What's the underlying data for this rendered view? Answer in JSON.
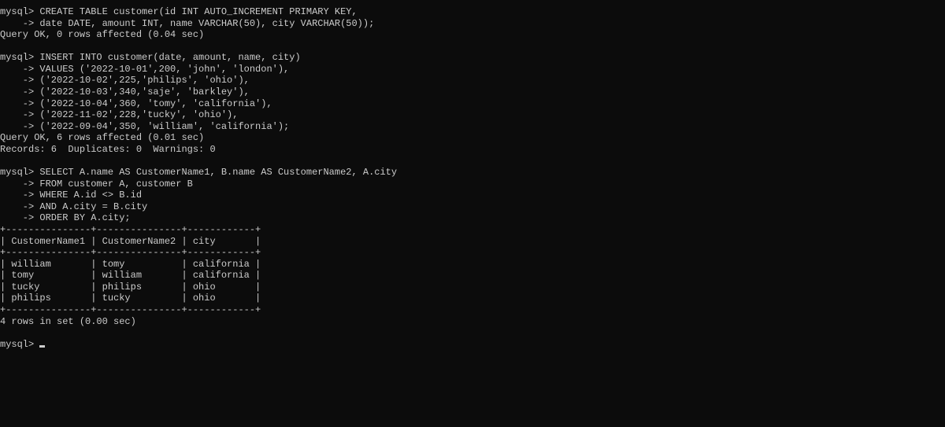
{
  "terminal": {
    "lines": [
      "mysql> CREATE TABLE customer(id INT AUTO_INCREMENT PRIMARY KEY,",
      "    -> date DATE, amount INT, name VARCHAR(50), city VARCHAR(50));",
      "Query OK, 0 rows affected (0.04 sec)",
      "",
      "mysql> INSERT INTO customer(date, amount, name, city)",
      "    -> VALUES ('2022-10-01',200, 'john', 'london'),",
      "    -> ('2022-10-02',225,'philips', 'ohio'),",
      "    -> ('2022-10-03',340,'saje', 'barkley'),",
      "    -> ('2022-10-04',360, 'tomy', 'california'),",
      "    -> ('2022-11-02',228,'tucky', 'ohio'),",
      "    -> ('2022-09-04',350, 'william', 'california');",
      "Query OK, 6 rows affected (0.01 sec)",
      "Records: 6  Duplicates: 0  Warnings: 0",
      "",
      "mysql> SELECT A.name AS CustomerName1, B.name AS CustomerName2, A.city",
      "    -> FROM customer A, customer B",
      "    -> WHERE A.id <> B.id",
      "    -> AND A.city = B.city",
      "    -> ORDER BY A.city;",
      "+---------------+---------------+------------+",
      "| CustomerName1 | CustomerName2 | city       |",
      "+---------------+---------------+------------+",
      "| william       | tomy          | california |",
      "| tomy          | william       | california |",
      "| tucky         | philips       | ohio       |",
      "| philips       | tucky         | ohio       |",
      "+---------------+---------------+------------+",
      "4 rows in set (0.00 sec)",
      ""
    ],
    "prompt": "mysql> ",
    "input_value": ""
  },
  "colors": {
    "background": "#0c0c0c",
    "text": "#cccccc"
  }
}
